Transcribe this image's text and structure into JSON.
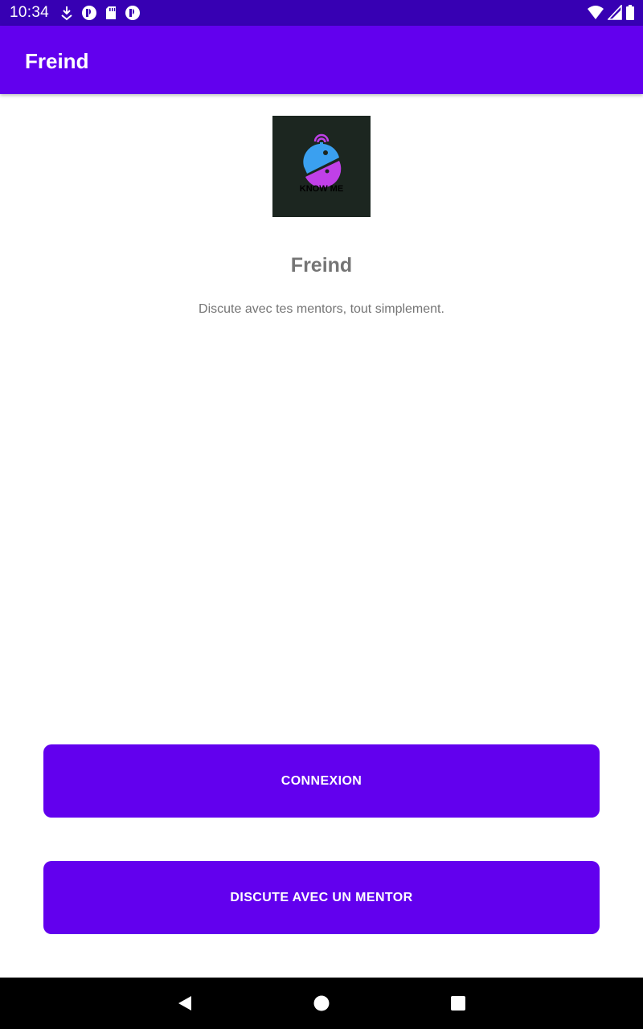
{
  "status_bar": {
    "time": "10:34",
    "left_icons": [
      "download-icon",
      "app-notification-icon",
      "sd-card-icon",
      "app-notification-icon"
    ],
    "right_icons": [
      "wifi-icon",
      "cell-signal-icon",
      "battery-icon"
    ]
  },
  "app_bar": {
    "title": "Freind"
  },
  "logo": {
    "text": "KNOW ME",
    "colors": {
      "background": "#1c2620",
      "top": "#3aa0f0",
      "bottom": "#c040e8"
    }
  },
  "main": {
    "brand_name": "Freind",
    "tagline": "Discute avec tes mentors, tout simplement."
  },
  "buttons": {
    "connexion_label": "CONNEXION",
    "mentor_label": "DISCUTE AVEC UN MENTOR"
  },
  "nav_bar": {
    "icons": [
      "back-icon",
      "home-icon",
      "recents-icon"
    ]
  },
  "colors": {
    "primary": "#6200ee",
    "primary_dark": "#3700b3",
    "text_secondary": "#757575"
  }
}
